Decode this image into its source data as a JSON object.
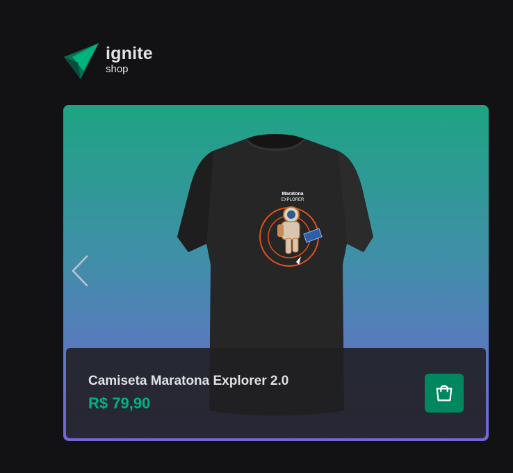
{
  "header": {
    "brand_title": "ignite",
    "brand_subtitle": "shop"
  },
  "product": {
    "name": "Camiseta Maratona Explorer 2.0",
    "price": "R$ 79,90",
    "shirt_print_line1": "Maratona",
    "shirt_print_line2": "EXPLORER"
  },
  "icons": {
    "logo": "ignite-logo-icon",
    "prev": "chevron-left-icon",
    "cart": "shopping-bag-icon"
  },
  "colors": {
    "background": "#121214",
    "card_gradient_top": "#1ea483",
    "card_gradient_bottom": "#7465d4",
    "price": "#00b37e",
    "cart_button": "#00875f",
    "text": "#e1e1e6"
  }
}
